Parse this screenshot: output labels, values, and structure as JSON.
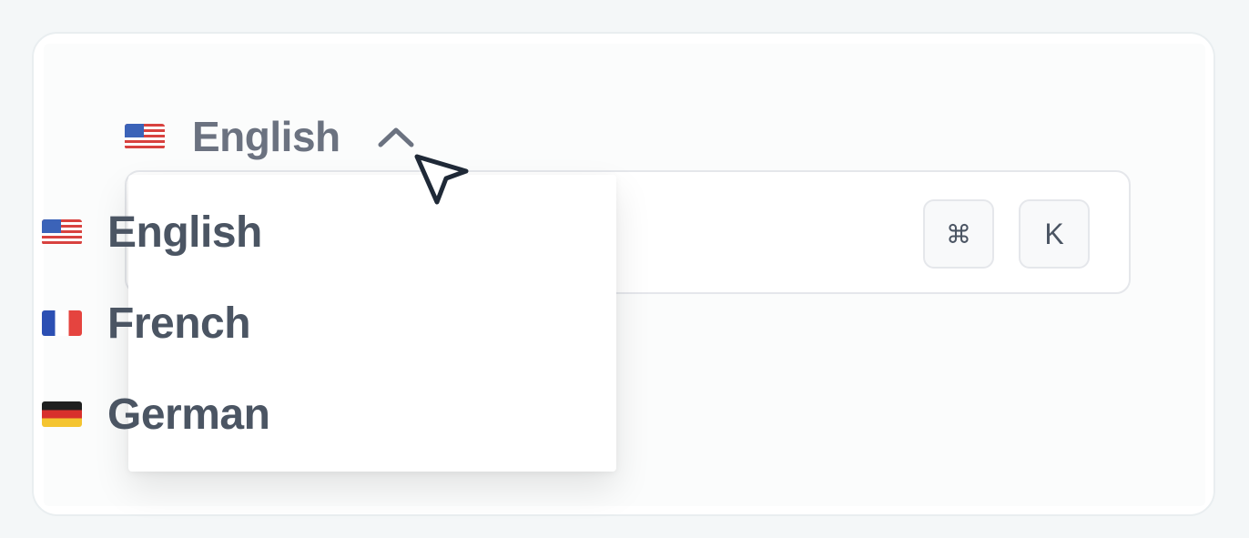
{
  "language_selector": {
    "selected_label": "English",
    "selected_flag": "us-flag-icon",
    "chevron_icon": "chevron-up-icon"
  },
  "language_menu": {
    "items": [
      {
        "label": "English",
        "flag": "us-flag-icon"
      },
      {
        "label": "French",
        "flag": "france-flag-icon"
      },
      {
        "label": "German",
        "flag": "germany-flag-icon"
      }
    ]
  },
  "search": {
    "shortcut_keys": [
      "⌘",
      "K"
    ]
  },
  "cursor_icon": "pointer-cursor-icon",
  "colors": {
    "text_muted": "#6b7280",
    "text_strong": "#4b5563",
    "border": "#e5e7eb"
  }
}
